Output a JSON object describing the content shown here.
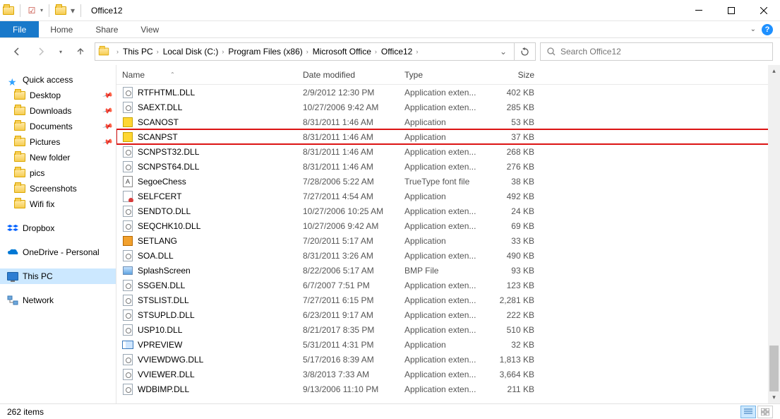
{
  "window": {
    "title": "Office12"
  },
  "ribbon": {
    "file": "File",
    "tabs": [
      "Home",
      "Share",
      "View"
    ]
  },
  "breadcrumbs": [
    "This PC",
    "Local Disk (C:)",
    "Program Files (x86)",
    "Microsoft Office",
    "Office12"
  ],
  "search": {
    "placeholder": "Search Office12"
  },
  "columns": {
    "name": "Name",
    "date": "Date modified",
    "type": "Type",
    "size": "Size"
  },
  "sidebar": {
    "quick_access": "Quick access",
    "items": [
      {
        "label": "Desktop",
        "pinned": true
      },
      {
        "label": "Downloads",
        "pinned": true
      },
      {
        "label": "Documents",
        "pinned": true
      },
      {
        "label": "Pictures",
        "pinned": true
      },
      {
        "label": "New folder"
      },
      {
        "label": "pics"
      },
      {
        "label": "Screenshots"
      },
      {
        "label": "Wifi fix"
      }
    ],
    "dropbox": "Dropbox",
    "onedrive": "OneDrive - Personal",
    "thispc": "This PC",
    "network": "Network"
  },
  "files": [
    {
      "name": "RTFHTML.DLL",
      "date": "2/9/2012 12:30 PM",
      "type": "Application exten...",
      "size": "402 KB",
      "icon": "dll"
    },
    {
      "name": "SAEXT.DLL",
      "date": "10/27/2006 9:42 AM",
      "type": "Application exten...",
      "size": "285 KB",
      "icon": "dll"
    },
    {
      "name": "SCANOST",
      "date": "8/31/2011 1:46 AM",
      "type": "Application",
      "size": "53 KB",
      "icon": "exe2"
    },
    {
      "name": "SCANPST",
      "date": "8/31/2011 1:46 AM",
      "type": "Application",
      "size": "37 KB",
      "icon": "exe2",
      "hl": true
    },
    {
      "name": "SCNPST32.DLL",
      "date": "8/31/2011 1:46 AM",
      "type": "Application exten...",
      "size": "268 KB",
      "icon": "dll"
    },
    {
      "name": "SCNPST64.DLL",
      "date": "8/31/2011 1:46 AM",
      "type": "Application exten...",
      "size": "276 KB",
      "icon": "dll"
    },
    {
      "name": "SegoeChess",
      "date": "7/28/2006 5:22 AM",
      "type": "TrueType font file",
      "size": "38 KB",
      "icon": "font"
    },
    {
      "name": "SELFCERT",
      "date": "7/27/2011 4:54 AM",
      "type": "Application",
      "size": "492 KB",
      "icon": "cert"
    },
    {
      "name": "SENDTO.DLL",
      "date": "10/27/2006 10:25 AM",
      "type": "Application exten...",
      "size": "24 KB",
      "icon": "dll"
    },
    {
      "name": "SEQCHK10.DLL",
      "date": "10/27/2006 9:42 AM",
      "type": "Application exten...",
      "size": "69 KB",
      "icon": "dll"
    },
    {
      "name": "SETLANG",
      "date": "7/20/2011 5:17 AM",
      "type": "Application",
      "size": "33 KB",
      "icon": "exe3"
    },
    {
      "name": "SOA.DLL",
      "date": "8/31/2011 3:26 AM",
      "type": "Application exten...",
      "size": "490 KB",
      "icon": "dll"
    },
    {
      "name": "SplashScreen",
      "date": "8/22/2006 5:17 AM",
      "type": "BMP File",
      "size": "93 KB",
      "icon": "bmp"
    },
    {
      "name": "SSGEN.DLL",
      "date": "6/7/2007 7:51 PM",
      "type": "Application exten...",
      "size": "123 KB",
      "icon": "dll"
    },
    {
      "name": "STSLIST.DLL",
      "date": "7/27/2011 6:15 PM",
      "type": "Application exten...",
      "size": "2,281 KB",
      "icon": "dll"
    },
    {
      "name": "STSUPLD.DLL",
      "date": "6/23/2011 9:17 AM",
      "type": "Application exten...",
      "size": "222 KB",
      "icon": "dll"
    },
    {
      "name": "USP10.DLL",
      "date": "8/21/2017 8:35 PM",
      "type": "Application exten...",
      "size": "510 KB",
      "icon": "dll"
    },
    {
      "name": "VPREVIEW",
      "date": "5/31/2011 4:31 PM",
      "type": "Application",
      "size": "32 KB",
      "icon": "vp"
    },
    {
      "name": "VVIEWDWG.DLL",
      "date": "5/17/2016 8:39 AM",
      "type": "Application exten...",
      "size": "1,813 KB",
      "icon": "dll"
    },
    {
      "name": "VVIEWER.DLL",
      "date": "3/8/2013 7:33 AM",
      "type": "Application exten...",
      "size": "3,664 KB",
      "icon": "dll"
    },
    {
      "name": "WDBIMP.DLL",
      "date": "9/13/2006 11:10 PM",
      "type": "Application exten...",
      "size": "211 KB",
      "icon": "dll"
    }
  ],
  "status": {
    "count": "262 items"
  }
}
